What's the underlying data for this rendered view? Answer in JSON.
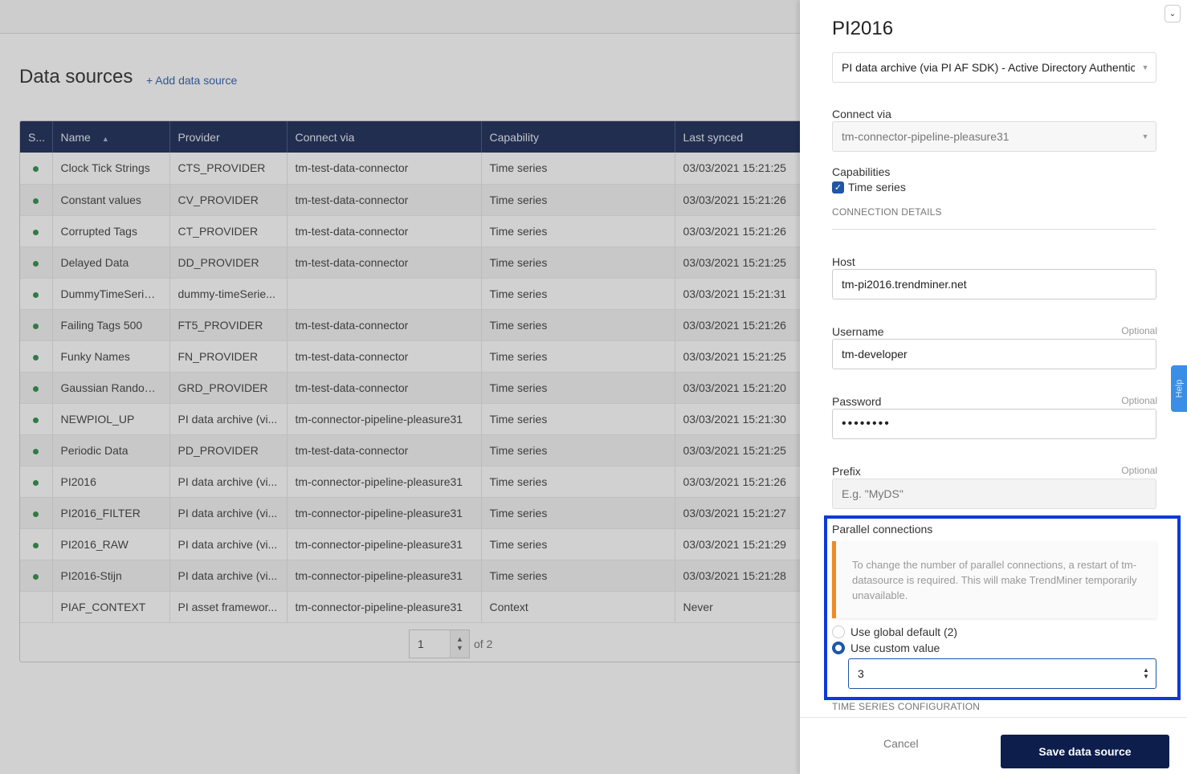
{
  "page": {
    "title": "Data sources",
    "add_link": "+ Add data source"
  },
  "table": {
    "headers": [
      "S...",
      "Name",
      "Provider",
      "Connect via",
      "Capability",
      "Last synced"
    ],
    "sort_indicator": "▲",
    "rows": [
      {
        "status": true,
        "name": "Clock Tick Strings",
        "provider": "CTS_PROVIDER",
        "connect": "tm-test-data-connector",
        "capability": "Time series",
        "synced": "03/03/2021 15:21:25"
      },
      {
        "status": true,
        "name": "Constant values",
        "provider": "CV_PROVIDER",
        "connect": "tm-test-data-connector",
        "capability": "Time series",
        "synced": "03/03/2021 15:21:26"
      },
      {
        "status": true,
        "name": "Corrupted Tags",
        "provider": "CT_PROVIDER",
        "connect": "tm-test-data-connector",
        "capability": "Time series",
        "synced": "03/03/2021 15:21:26"
      },
      {
        "status": true,
        "name": "Delayed Data",
        "provider": "DD_PROVIDER",
        "connect": "tm-test-data-connector",
        "capability": "Time series",
        "synced": "03/03/2021 15:21:25"
      },
      {
        "status": true,
        "name": "DummyTimeSeries...",
        "provider": "dummy-timeSerie...",
        "connect": "",
        "capability": "Time series",
        "synced": "03/03/2021 15:21:31"
      },
      {
        "status": true,
        "name": "Failing Tags 500",
        "provider": "FT5_PROVIDER",
        "connect": "tm-test-data-connector",
        "capability": "Time series",
        "synced": "03/03/2021 15:21:26"
      },
      {
        "status": true,
        "name": "Funky Names",
        "provider": "FN_PROVIDER",
        "connect": "tm-test-data-connector",
        "capability": "Time series",
        "synced": "03/03/2021 15:21:25"
      },
      {
        "status": true,
        "name": "Gaussian Random ...",
        "provider": "GRD_PROVIDER",
        "connect": "tm-test-data-connector",
        "capability": "Time series",
        "synced": "03/03/2021 15:21:20"
      },
      {
        "status": true,
        "name": "NEWPIOL_UP",
        "provider": "PI data archive (vi...",
        "connect": "tm-connector-pipeline-pleasure31",
        "capability": "Time series",
        "synced": "03/03/2021 15:21:30"
      },
      {
        "status": true,
        "name": "Periodic Data",
        "provider": "PD_PROVIDER",
        "connect": "tm-test-data-connector",
        "capability": "Time series",
        "synced": "03/03/2021 15:21:25"
      },
      {
        "status": true,
        "name": "PI2016",
        "provider": "PI data archive (vi...",
        "connect": "tm-connector-pipeline-pleasure31",
        "capability": "Time series",
        "synced": "03/03/2021 15:21:26"
      },
      {
        "status": true,
        "name": "PI2016_FILTER",
        "provider": "PI data archive (vi...",
        "connect": "tm-connector-pipeline-pleasure31",
        "capability": "Time series",
        "synced": "03/03/2021 15:21:27"
      },
      {
        "status": true,
        "name": "PI2016_RAW",
        "provider": "PI data archive (vi...",
        "connect": "tm-connector-pipeline-pleasure31",
        "capability": "Time series",
        "synced": "03/03/2021 15:21:29"
      },
      {
        "status": true,
        "name": "PI2016-Stijn",
        "provider": "PI data archive (vi...",
        "connect": "tm-connector-pipeline-pleasure31",
        "capability": "Time series",
        "synced": "03/03/2021 15:21:28"
      },
      {
        "status": false,
        "name": "PIAF_CONTEXT",
        "provider": "PI asset framewor...",
        "connect": "tm-connector-pipeline-pleasure31",
        "capability": "Context",
        "synced": "Never"
      }
    ]
  },
  "pager": {
    "page": "1",
    "of_label": "of 2"
  },
  "panel": {
    "title": "PI2016",
    "provider_value": "PI data archive (via PI AF SDK) - Active Directory Authentication",
    "connect_via_label": "Connect via",
    "connect_via_value": "tm-connector-pipeline-pleasure31",
    "capabilities_label": "Capabilities",
    "capability_checkbox": "Time series",
    "connection_details": "CONNECTION DETAILS",
    "host_label": "Host",
    "host_value": "tm-pi2016.trendminer.net",
    "username_label": "Username",
    "username_value": "tm-developer",
    "password_label": "Password",
    "password_value": "••••••••",
    "prefix_label": "Prefix",
    "prefix_placeholder": "E.g. \"MyDS\"",
    "optional": "Optional",
    "parallel_label": "Parallel connections",
    "notice": "To change the number of parallel connections, a restart of tm-datasource is required. This will make TrendMiner temporarily unavailable.",
    "radio_global": "Use global default (2)",
    "radio_custom": "Use custom value",
    "custom_value": "3",
    "time_series_config": "TIME SERIES CONFIGURATION",
    "cancel": "Cancel",
    "save": "Save data source"
  },
  "help_tab": "Help",
  "colors": {
    "header_navy": "#0d1e4d",
    "accent_blue": "#1f56a8",
    "highlight_blue": "#0b3bd6",
    "notice_orange": "#f08a24",
    "status_green": "#1e8a3c"
  }
}
